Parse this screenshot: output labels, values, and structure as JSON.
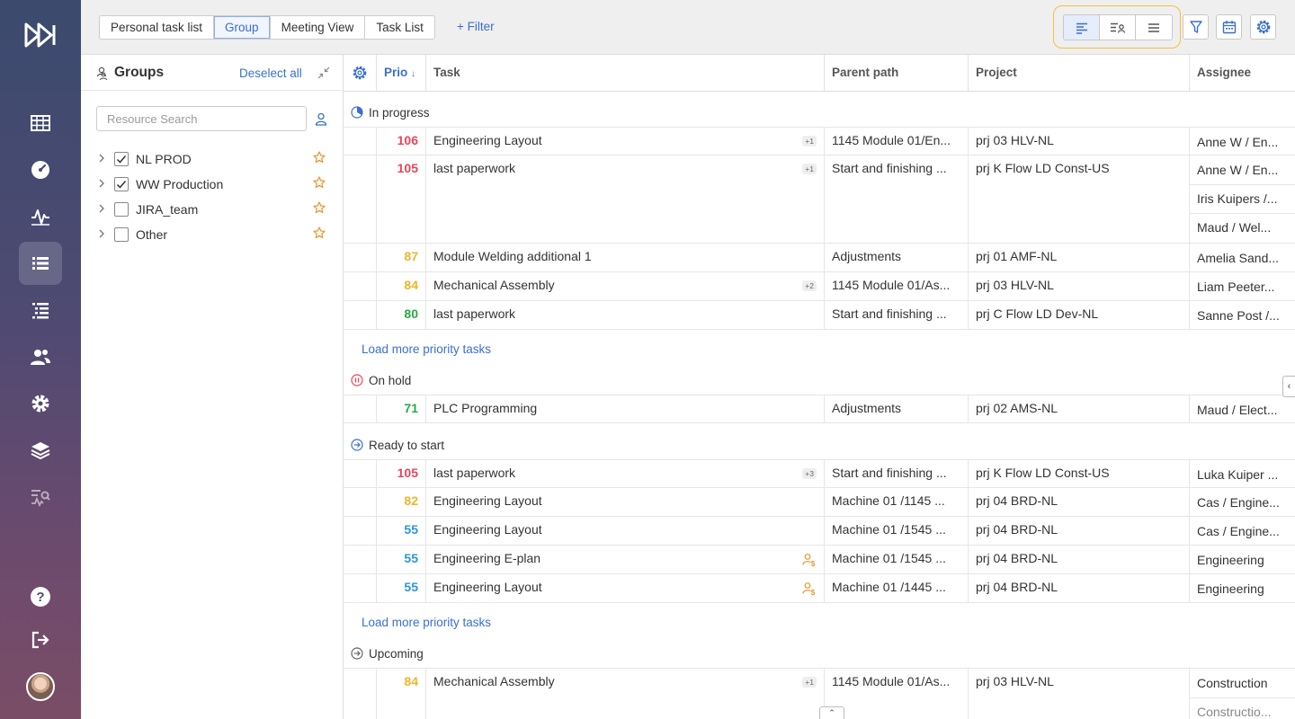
{
  "topbar": {
    "tabs": [
      {
        "label": "Personal task list",
        "active": false
      },
      {
        "label": "Group",
        "active": true
      },
      {
        "label": "Meeting View",
        "active": false
      },
      {
        "label": "Task List",
        "active": false
      }
    ],
    "filter_label": "+ Filter"
  },
  "groups": {
    "title": "Groups",
    "deselect_label": "Deselect all",
    "search_placeholder": "Resource Search",
    "items": [
      {
        "label": "NL PROD",
        "checked": true
      },
      {
        "label": "WW Production",
        "checked": true
      },
      {
        "label": "JIRA_team",
        "checked": false
      },
      {
        "label": "Other",
        "checked": false
      }
    ]
  },
  "table": {
    "headers": {
      "prio": "Prio",
      "task": "Task",
      "parent": "Parent path",
      "project": "Project",
      "assignee": "Assignee"
    },
    "sections": {
      "in_progress": "In progress",
      "on_hold": "On hold",
      "ready": "Ready to start",
      "upcoming": "Upcoming"
    },
    "load_more": "Load more priority tasks",
    "rows": [
      {
        "prio": "106",
        "task": "Engineering Layout",
        "badge": "+1",
        "parent": "1145 Module 01/En...",
        "project": "prj 03 HLV-NL",
        "assignees": [
          "Anne W / En..."
        ]
      },
      {
        "prio": "105",
        "task": "last paperwork",
        "badge": "+1",
        "parent": "Start and finishing ...",
        "project": "prj K Flow LD Const-US",
        "assignees": [
          "Anne W / En...",
          "Iris Kuipers /...",
          "Maud / Wel..."
        ]
      },
      {
        "prio": "87",
        "task": "Module Welding additional 1",
        "badge": "",
        "parent": "Adjustments",
        "project": "prj 01 AMF-NL",
        "assignees": [
          "Amelia Sand..."
        ]
      },
      {
        "prio": "84",
        "task": "Mechanical Assembly",
        "badge": "+2",
        "parent": "1145 Module 01/As...",
        "project": "prj 03 HLV-NL",
        "assignees": [
          "Liam Peeter..."
        ]
      },
      {
        "prio": "80",
        "task": "last paperwork",
        "badge": "",
        "parent": "Start and finishing ...",
        "project": "prj C Flow LD Dev-NL",
        "assignees": [
          "Sanne Post /..."
        ]
      },
      {
        "prio": "71",
        "task": "PLC Programming",
        "badge": "",
        "parent": "Adjustments",
        "project": "prj 02 AMS-NL",
        "assignees": [
          "Maud / Elect..."
        ]
      },
      {
        "prio": "105",
        "task": "last paperwork",
        "badge": "+3",
        "parent": "Start and finishing ...",
        "project": "prj K Flow LD Const-US",
        "assignees": [
          "Luka Kuiper ..."
        ]
      },
      {
        "prio": "82",
        "task": "Engineering Layout",
        "badge": "",
        "parent": "Machine 01 /1145 ...",
        "project": "prj 04 BRD-NL",
        "assignees": [
          "Cas / Engine..."
        ]
      },
      {
        "prio": "55",
        "task": "Engineering Layout",
        "badge": "",
        "parent": "Machine 01 /1545 ...",
        "project": "prj 04 BRD-NL",
        "assignees": [
          "Cas / Engine..."
        ]
      },
      {
        "prio": "55",
        "task": "Engineering E-plan",
        "badge": "",
        "parent": "Machine 01 /1545 ...",
        "project": "prj 04 BRD-NL",
        "assignees": [
          "Engineering"
        ]
      },
      {
        "prio": "55",
        "task": "Engineering Layout",
        "badge": "",
        "parent": "Machine 01 /1445 ...",
        "project": "prj 04 BRD-NL",
        "assignees": [
          "Engineering"
        ]
      },
      {
        "prio": "84",
        "task": "Mechanical Assembly",
        "badge": "+1",
        "parent": "1145 Module 01/As...",
        "project": "prj 03 HLV-NL",
        "assignees": [
          "Construction",
          "Constructio..."
        ]
      }
    ]
  },
  "colors": {
    "accent": "#3a6fd0",
    "prio_red": "#e8455a",
    "prio_yellow": "#f0b429",
    "prio_green": "#2aa845",
    "prio_blue": "#2b95de",
    "highlight": "#f1c040"
  }
}
